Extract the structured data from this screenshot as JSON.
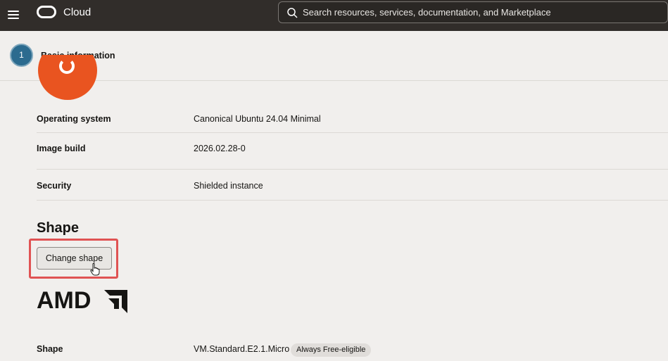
{
  "topbar": {
    "brand": "Cloud",
    "search": {
      "placeholder": "Search resources, services, documentation, and Marketplace"
    }
  },
  "section": {
    "step_number": "1",
    "title": "Basic information"
  },
  "image_details": [
    {
      "label": "Operating system",
      "value": "Canonical Ubuntu 24.04 Minimal"
    },
    {
      "label": "Image build",
      "value": "2026.02.28-0"
    },
    {
      "label": "Security",
      "value": "Shielded instance"
    }
  ],
  "shape": {
    "heading": "Shape",
    "change_button": "Change shape",
    "vendor_logo_text": "AMD",
    "row_label": "Shape",
    "row_value": "VM.Standard.E2.1.Micro",
    "badge": "Always Free-eligible"
  },
  "colors": {
    "topbar": "#312d2a",
    "step_circle": "#2c6b8f",
    "ubuntu": "#e95420",
    "highlight": "#e05353"
  }
}
